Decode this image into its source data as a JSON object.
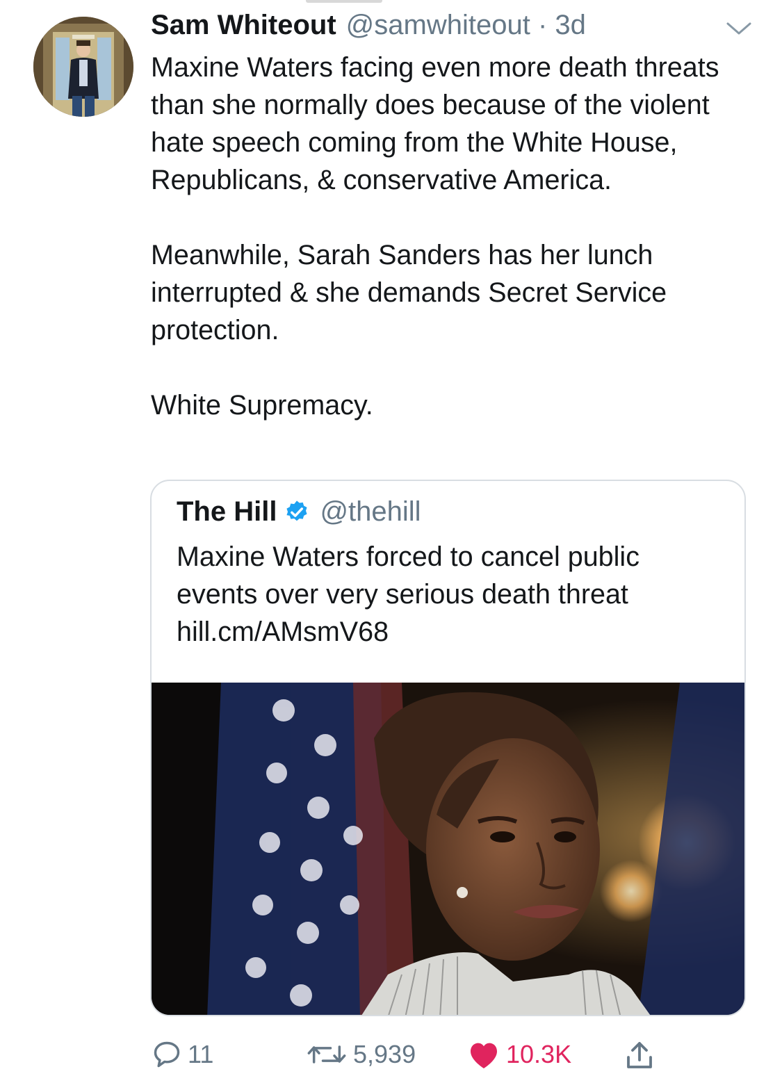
{
  "tweet": {
    "author_name": "Sam Whiteout",
    "author_meta": "@samwhiteout · 3d",
    "paragraphs": [
      "Maxine Waters facing even more death threats than she normally does because of the violent hate speech coming from the White House, Republicans, & conservative America.",
      "Meanwhile, Sarah Sanders has her lunch interrupted & she demands Secret Service protection.",
      "White Supremacy."
    ]
  },
  "quoted": {
    "name": "The Hill",
    "handle": "@thehill",
    "text_lines": [
      "Maxine Waters forced to cancel public",
      "events over very serious death threat",
      "hill.cm/AMsmV68"
    ]
  },
  "actions": {
    "replies": "11",
    "retweets": "5,939",
    "likes": "10.3K"
  },
  "icons": {
    "menu": "chevron-down-icon",
    "verified": "verified-badge-icon",
    "reply": "reply-icon",
    "retweet": "retweet-icon",
    "like": "heart-icon",
    "share": "share-icon"
  },
  "colors": {
    "text": "#14171a",
    "secondary": "#657786",
    "verified": "#1da1f2",
    "like": "#e0245e",
    "border": "#d8dde2"
  }
}
